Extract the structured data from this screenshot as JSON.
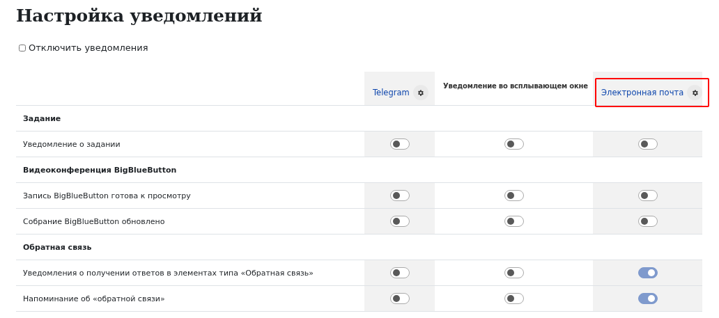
{
  "title": "Настройка уведомлений",
  "disable_all": {
    "label": "Отключить уведомления",
    "checked": false
  },
  "columns": [
    {
      "label": "Telegram",
      "kind": "link"
    },
    {
      "label": "Уведомление во всплывающем окне",
      "kind": "plain"
    },
    {
      "label": "Электронная почта",
      "kind": "link",
      "highlighted": true
    }
  ],
  "rows": [
    {
      "kind": "section",
      "label": "Задание"
    },
    {
      "kind": "setting",
      "label": "Уведомление о задании",
      "toggles": [
        {
          "on": false
        },
        {
          "on": false
        },
        {
          "on": false
        }
      ]
    },
    {
      "kind": "section",
      "label": "Видеоконференция BigBlueButton"
    },
    {
      "kind": "setting",
      "label": "Запись BigBlueButton готова к просмотру",
      "toggles": [
        {
          "on": false
        },
        {
          "on": false
        },
        {
          "on": false
        }
      ]
    },
    {
      "kind": "setting",
      "label": "Собрание BigBlueButton обновлено",
      "toggles": [
        {
          "on": false
        },
        {
          "on": false
        },
        {
          "on": false
        }
      ]
    },
    {
      "kind": "section",
      "label": "Обратная связь"
    },
    {
      "kind": "setting",
      "label": "Уведомления о получении ответов в элементах типа «Обратная связь»",
      "toggles": [
        {
          "on": false
        },
        {
          "on": false
        },
        {
          "on": true
        }
      ]
    },
    {
      "kind": "setting",
      "label": "Напоминание об «обратной связи»",
      "toggles": [
        {
          "on": false
        },
        {
          "on": false
        },
        {
          "on": true
        }
      ]
    }
  ]
}
